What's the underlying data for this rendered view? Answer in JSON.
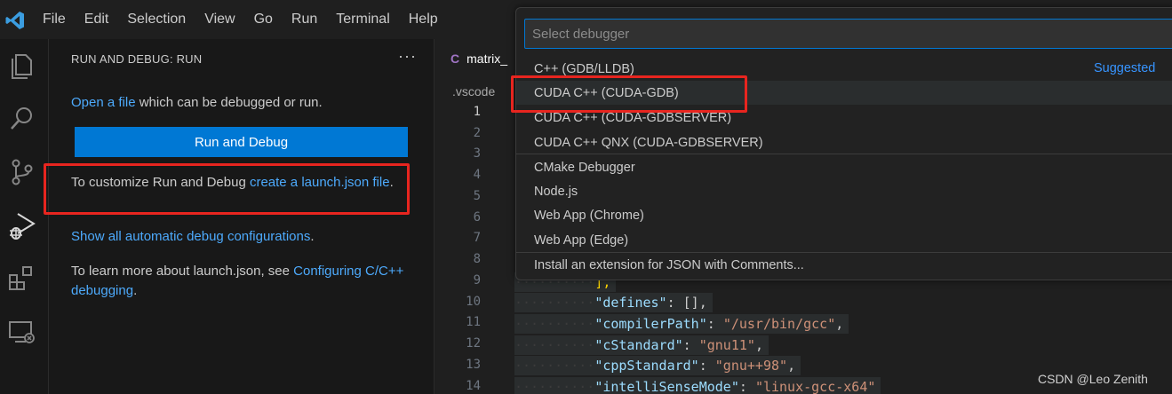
{
  "menu": [
    "File",
    "Edit",
    "Selection",
    "View",
    "Go",
    "Run",
    "Terminal",
    "Help"
  ],
  "sidebar": {
    "title": "RUN AND DEBUG: RUN",
    "more": "···",
    "open_file_link": "Open a file",
    "open_file_rest": " which can be debugged or run.",
    "run_button": "Run and Debug",
    "customize_text": "To customize Run and Debug ",
    "customize_link": "create a launch.json file",
    "customize_end": ".",
    "show_all_link": "Show all automatic debug configurations",
    "show_all_end": ".",
    "learn_text": "To learn more about launch.json, see ",
    "learn_link": "Configuring C/C++ debugging",
    "learn_end": "."
  },
  "editor": {
    "tab_icon": "C",
    "tab_label": "matrix_",
    "breadcrumb": ".vscode",
    "line_numbers": [
      "1",
      "2",
      "3",
      "4",
      "5",
      "6",
      "7",
      "8",
      "9",
      "10",
      "11",
      "12",
      "13",
      "14"
    ],
    "code": {
      "l9_indent": "··········",
      "l9_text": "],",
      "l10_indent": "··········",
      "l10_key": "\"defines\"",
      "l10_rest": ": [],",
      "l11_indent": "··········",
      "l11_key": "\"compilerPath\"",
      "l11_colon": ": ",
      "l11_val": "\"/usr/bin/gcc\"",
      "l11_end": ",",
      "l12_indent": "··········",
      "l12_key": "\"cStandard\"",
      "l12_colon": ": ",
      "l12_val": "\"gnu11\"",
      "l12_end": ",",
      "l13_indent": "··········",
      "l13_key": "\"cppStandard\"",
      "l13_colon": ": ",
      "l13_val": "\"gnu++98\"",
      "l13_end": ",",
      "l14_indent": "··········",
      "l14_key": "\"intelliSenseMode\"",
      "l14_colon": ": ",
      "l14_val": "\"linux-gcc-x64\""
    }
  },
  "quickpick": {
    "placeholder": "Select debugger",
    "suggested_label": "Suggested",
    "items": [
      "C++ (GDB/LLDB)",
      "CUDA C++ (CUDA-GDB)",
      "CUDA C++ (CUDA-GDBSERVER)",
      "CUDA C++ QNX (CUDA-GDBSERVER)",
      "CMake Debugger",
      "Node.js",
      "Web App (Chrome)",
      "Web App (Edge)",
      "Install an extension for JSON with Comments..."
    ]
  },
  "watermark": "CSDN @Leo Zenith",
  "colors": {
    "accent": "#0078d4",
    "link": "#4daafc",
    "highlight_box": "#e8251f",
    "suggested": "#3794ff"
  }
}
